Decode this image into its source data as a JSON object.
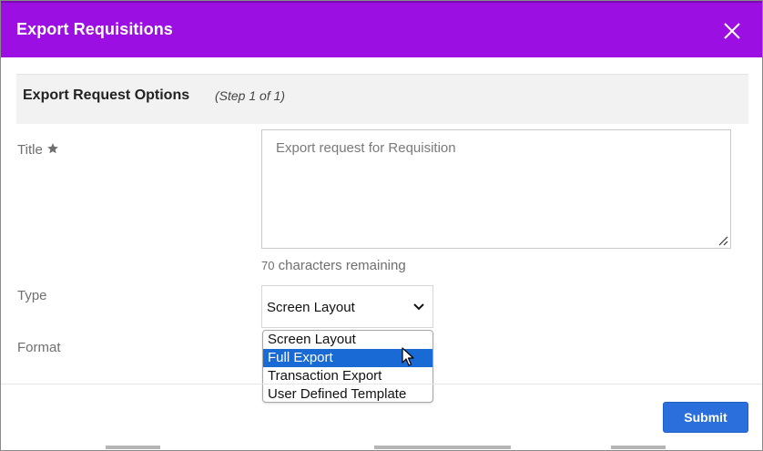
{
  "dialog": {
    "title": "Export Requisitions",
    "close_icon": "close-icon"
  },
  "section": {
    "title": "Export Request Options",
    "step": "(Step 1 of 1)"
  },
  "form": {
    "title_label": "Title",
    "title_required_icon": "star-icon",
    "title_placeholder": "Export request for Requisition",
    "chars_remaining_count": "70",
    "chars_remaining_text": "characters remaining",
    "type_label": "Type",
    "type_selected": "Screen Layout",
    "format_label": "Format",
    "type_options": [
      "Screen Layout",
      "Full Export",
      "Transaction Export",
      "User Defined Template"
    ],
    "highlighted_option": "Full Export"
  },
  "footer": {
    "submit_label": "Submit"
  },
  "colors": {
    "header_bg": "#9c0fe3",
    "primary_button": "#2a6fdc",
    "dropdown_highlight": "#1a6ad6"
  }
}
